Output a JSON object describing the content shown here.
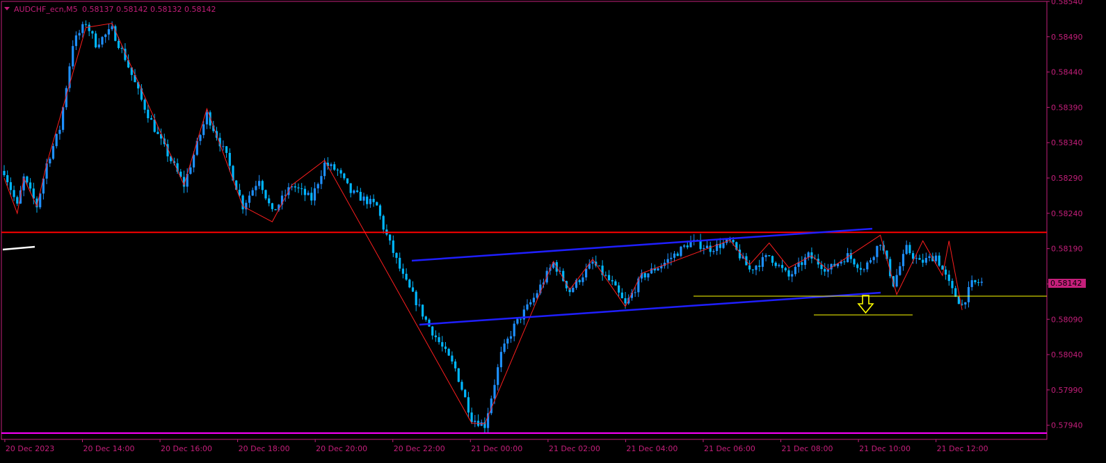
{
  "header": {
    "symbol_timeframe": "AUDCHF_ecn,M5",
    "ohlc": "0.58137 0.58142 0.58132 0.58142"
  },
  "colors": {
    "background": "#000000",
    "axis": "#c51f7b",
    "candle_up": "#1e90ff",
    "candle_down": "#00b7ff",
    "zigzag": "#ff1e1e",
    "resistance": "#ff0000",
    "channel": "#1f1fff",
    "support_box": "#ffff00",
    "bottom_line": "#ff00ff"
  },
  "price_tag": "0.58142",
  "chart_data": {
    "type": "candlestick",
    "title": "",
    "y_axis_side": "right",
    "ylim": [
      0.5792,
      0.5854
    ],
    "y_ticks": [
      "0.58540",
      "0.58490",
      "0.58440",
      "0.58390",
      "0.58340",
      "0.58290",
      "0.58240",
      "0.58190",
      "0.58140",
      "0.58090",
      "0.58040",
      "0.57990",
      "0.57940"
    ],
    "y_tick_values": [
      0.5854,
      0.5849,
      0.5844,
      0.5839,
      0.5834,
      0.5829,
      0.5824,
      0.5819,
      0.5814,
      0.5809,
      0.5804,
      0.5799,
      0.5794
    ],
    "x_ticks": [
      "20 Dec 2023",
      "20 Dec 14:00",
      "20 Dec 16:00",
      "20 Dec 18:00",
      "20 Dec 20:00",
      "20 Dec 22:00",
      "21 Dec 00:00",
      "21 Dec 02:00",
      "21 Dec 04:00",
      "21 Dec 06:00",
      "21 Dec 08:00",
      "21 Dec 10:00",
      "21 Dec 12:00"
    ],
    "x_tick_bars": [
      0,
      24,
      48,
      72,
      96,
      120,
      144,
      168,
      192,
      216,
      240,
      264,
      288
    ],
    "bar_count": 300,
    "price_path": [
      [
        0,
        0.583
      ],
      [
        4,
        0.5825
      ],
      [
        6,
        0.5829
      ],
      [
        10,
        0.5825
      ],
      [
        13,
        0.5831
      ],
      [
        17,
        0.5836
      ],
      [
        21,
        0.5848
      ],
      [
        25,
        0.5851
      ],
      [
        28,
        0.5848
      ],
      [
        33,
        0.585
      ],
      [
        37,
        0.5846
      ],
      [
        42,
        0.584
      ],
      [
        47,
        0.5835
      ],
      [
        55,
        0.5828
      ],
      [
        62,
        0.5838
      ],
      [
        68,
        0.5832
      ],
      [
        73,
        0.5825
      ],
      [
        78,
        0.5829
      ],
      [
        82,
        0.5824
      ],
      [
        88,
        0.5828
      ],
      [
        94,
        0.5826
      ],
      [
        98,
        0.5831
      ],
      [
        102,
        0.583
      ],
      [
        106,
        0.5827
      ],
      [
        110,
        0.5826
      ],
      [
        114,
        0.5825
      ],
      [
        116,
        0.5822
      ],
      [
        122,
        0.5815
      ],
      [
        130,
        0.5808
      ],
      [
        138,
        0.5802
      ],
      [
        143,
        0.5795
      ],
      [
        147,
        0.5794
      ],
      [
        152,
        0.5804
      ],
      [
        156,
        0.5808
      ],
      [
        162,
        0.5812
      ],
      [
        168,
        0.5817
      ],
      [
        173,
        0.5813
      ],
      [
        180,
        0.5817
      ],
      [
        186,
        0.5814
      ],
      [
        190,
        0.5811
      ],
      [
        195,
        0.5815
      ],
      [
        202,
        0.5817
      ],
      [
        210,
        0.582
      ],
      [
        216,
        0.5819
      ],
      [
        222,
        0.582
      ],
      [
        228,
        0.5816
      ],
      [
        234,
        0.5818
      ],
      [
        240,
        0.5815
      ],
      [
        246,
        0.5818
      ],
      [
        252,
        0.5816
      ],
      [
        258,
        0.5818
      ],
      [
        263,
        0.5816
      ],
      [
        268,
        0.582
      ],
      [
        272,
        0.5814
      ],
      [
        276,
        0.5819
      ],
      [
        280,
        0.5817
      ],
      [
        285,
        0.5818
      ],
      [
        290,
        0.5813
      ],
      [
        293,
        0.5811
      ],
      [
        296,
        0.5814
      ],
      [
        298,
        0.58142
      ]
    ],
    "zigzag_points": [
      [
        0,
        0.5829
      ],
      [
        4,
        0.5824
      ],
      [
        6,
        0.5829
      ],
      [
        10,
        0.5825
      ],
      [
        13,
        0.5831
      ],
      [
        25,
        0.58503
      ],
      [
        33,
        0.58509
      ],
      [
        55,
        0.5828
      ],
      [
        62,
        0.58388
      ],
      [
        73,
        0.5825
      ],
      [
        82,
        0.58228
      ],
      [
        88,
        0.5828
      ],
      [
        98,
        0.58315
      ],
      [
        143,
        0.57943
      ],
      [
        147,
        0.57942
      ],
      [
        168,
        0.58172
      ],
      [
        173,
        0.58132
      ],
      [
        180,
        0.58175
      ],
      [
        190,
        0.58108
      ],
      [
        195,
        0.58155
      ],
      [
        222,
        0.58202
      ],
      [
        228,
        0.58167
      ],
      [
        234,
        0.58198
      ],
      [
        240,
        0.58163
      ],
      [
        247,
        0.5818
      ],
      [
        252,
        0.5816
      ],
      [
        268,
        0.58209
      ],
      [
        273,
        0.58125
      ],
      [
        281,
        0.58201
      ],
      [
        287,
        0.58152
      ],
      [
        289,
        0.58201
      ],
      [
        293,
        0.58103
      ]
    ],
    "resistance_level": 0.58213,
    "channel_upper": [
      [
        93,
        0.58177
      ],
      [
        200,
        0.58225
      ]
    ],
    "channel_lower": [
      [
        95,
        0.58096
      ],
      [
        202,
        0.5813
      ]
    ],
    "support_box": {
      "x_start_bar": 159,
      "x_end_bar": 212,
      "top": 0.58127,
      "bottom": 0.581
    },
    "bottom_level": 0.57925
  }
}
